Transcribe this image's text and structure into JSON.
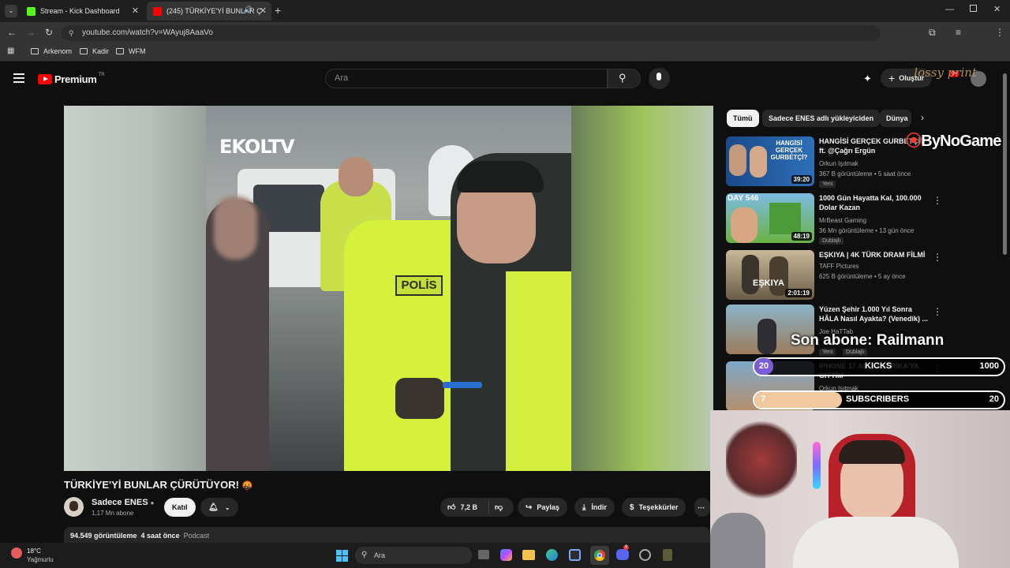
{
  "browser": {
    "tabs": [
      {
        "label": "Stream - Kick Dashboard",
        "active": false
      },
      {
        "label": "(245) TÜRKİYE'Yİ BUNLAR Ç",
        "active": true
      }
    ],
    "url": "youtube.com/watch?v=WAyuj8AaaVo",
    "bookmarks": [
      "Arkenom",
      "Kadir",
      "WFM"
    ]
  },
  "youtube": {
    "logo": "Premium",
    "region": "TR",
    "search_placeholder": "Ara",
    "create_label": "Oluştur",
    "notif_count": "9+",
    "video_title": "TÜRKİYE'Yİ BUNLAR ÇÜRÜTÜYOR!",
    "video_title_emoji": "🤬",
    "watermark": "EKOLTV",
    "channel": {
      "name": "Sadece ENES",
      "subs": "1,17 Mn abone",
      "join_label": "Katıl"
    },
    "actions": {
      "likes": "7,2 B",
      "share": "Paylaş",
      "download": "İndir",
      "thanks": "Teşekkürler"
    },
    "desc": {
      "views": "94.549 görüntüleme",
      "ago": "4 saat önce",
      "tag": "Podcast"
    },
    "chips": [
      "Tümü",
      "Sadece ENES adlı yükleyiciden",
      "Dünya"
    ],
    "recommendations": [
      {
        "title": "HANGİSİ GERÇEK GURBETÇİ? ft. @Çağrı Ergün",
        "channel": "Orkun Işıtmak",
        "meta": "367 B görüntüleme • 5 saat önce",
        "badge": "Yeni",
        "duration": "39:20",
        "thumb_text": "HANGİSİ GERÇEK GURBETÇİ?"
      },
      {
        "title": "1000 Gün Hayatta Kal, 100.000 Dolar Kazan",
        "channel": "MrBeast Gaming",
        "meta": "36 Mn görüntüleme • 13 gün önce",
        "badge": "Dublajlı",
        "duration": "48:19",
        "thumb_text": "DAY 546"
      },
      {
        "title": "EŞKIYA | 4K TÜRK DRAM FİLMİ",
        "channel": "TAFF Pictures",
        "meta": "625 B görüntüleme • 5 ay önce",
        "badge": "",
        "duration": "2:01:19",
        "thumb_text": "EŞKIYA"
      },
      {
        "title": "Yüzen Şehir 1.000 Yıl Sonra HÂLA Nasıl Ayakta? (Venedik) ...",
        "channel": "Joe HaTTab",
        "meta": "",
        "badge": "Yeni",
        "badge2": "Dublajlı",
        "duration": "",
        "thumb_text": ""
      },
      {
        "title": "IPHONE 17 AL... AMERİKA'YA GİTTİM",
        "channel": "Orkun Işıtmak",
        "meta": "",
        "badge": "",
        "duration": "",
        "thumb_text": ""
      }
    ]
  },
  "overlay": {
    "brand_top": "lossy print",
    "brand_side": "ByNoGame",
    "last_sub": "Son abone: Railmann",
    "kicks": {
      "label": "KICKS",
      "current": "20",
      "goal": "1000",
      "progress": 0.02
    },
    "subscribers": {
      "label": "SUBSCRIBERS",
      "current": "7",
      "goal": "20",
      "progress": 0.35
    }
  },
  "taskbar": {
    "weather_temp": "18°C",
    "weather_desc": "Yağmurlu",
    "search_placeholder": "Ara",
    "discord_badge": "9"
  },
  "colors": {
    "youtube_red": "#ff0000",
    "kick_green": "#53fc18",
    "overlay_purple": "#7b5cd6",
    "overlay_peach": "#f0c9a0"
  }
}
